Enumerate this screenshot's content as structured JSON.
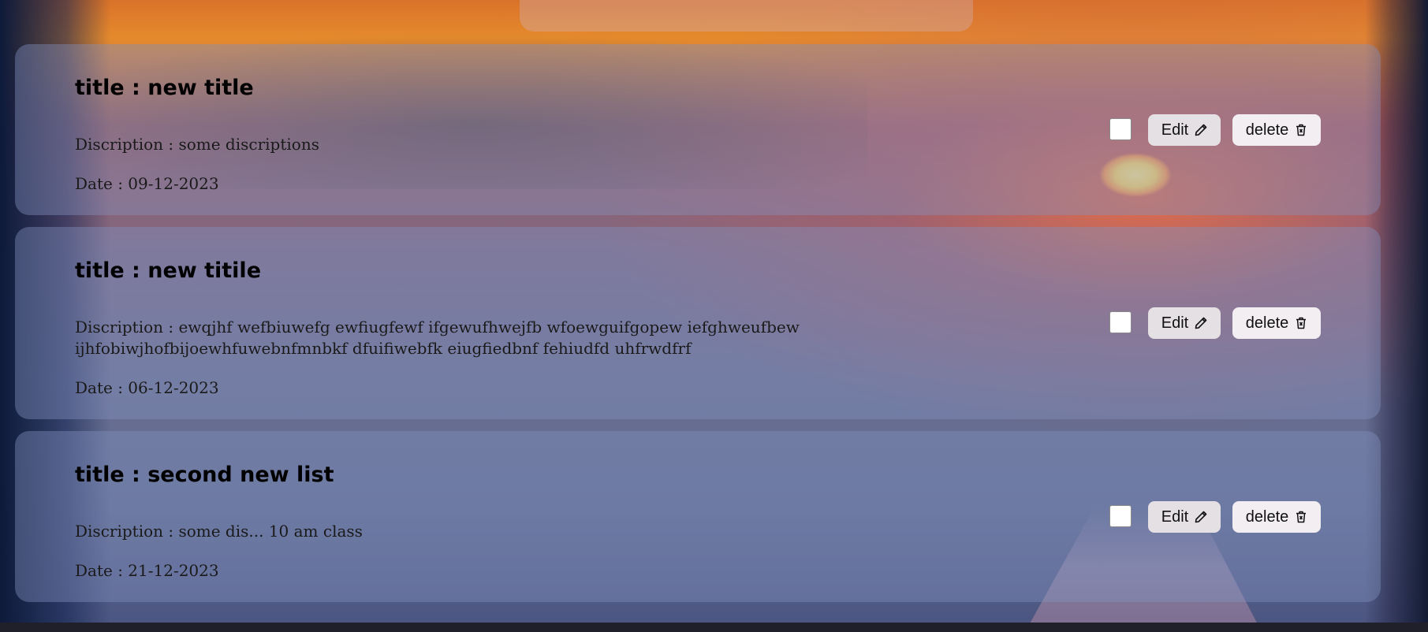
{
  "todos": [
    {
      "title": "title : new title",
      "description": "Discription : some discriptions",
      "date": "Date : 09-12-2023",
      "edit_label": "Edit",
      "delete_label": "delete",
      "checked": false
    },
    {
      "title": "title : new titile",
      "description": "Discription : ewqjhf wefbiuwefg ewfiugfewf ifgewufhwejfb wfoewguifgopew iefghweufbewijhfobiwjhofbijoewhfuwebnfmnbkf dfuifiwebfk eiugfiedbnf fehiudfd uhfrwdfrf",
      "date": "Date : 06-12-2023",
      "edit_label": "Edit",
      "delete_label": "delete",
      "checked": false
    },
    {
      "title": "title : second new list",
      "description": "Discription : some dis... 10 am class",
      "date": "Date : 21-12-2023",
      "edit_label": "Edit",
      "delete_label": "delete",
      "checked": false
    }
  ],
  "icons": {
    "edit": "pencil-icon",
    "delete": "trash-icon"
  },
  "colors": {
    "card_background": "#8291be",
    "edit_button": "#e4e0e3",
    "delete_button": "#f2eef2"
  }
}
